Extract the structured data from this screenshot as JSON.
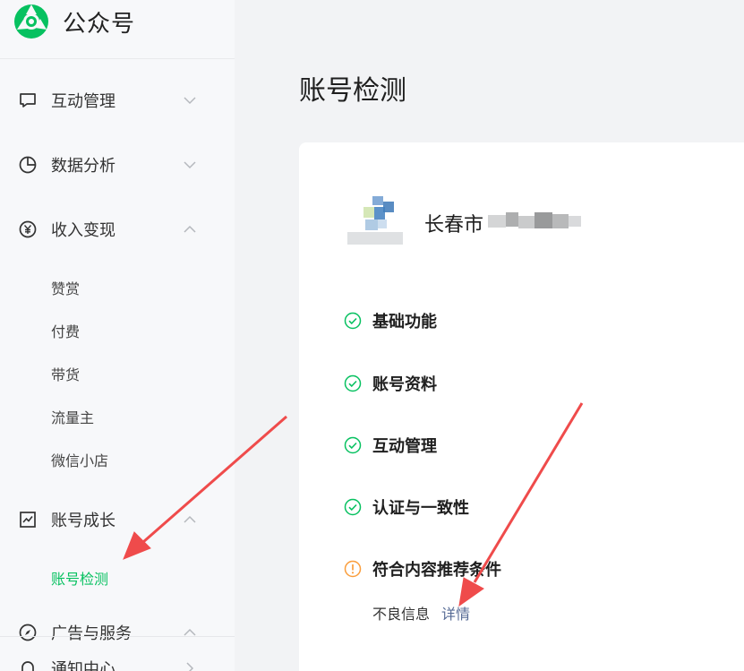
{
  "brand": {
    "name": "公众号"
  },
  "sidebar": {
    "items": [
      {
        "label": "互动管理",
        "icon": "chat-bubble-icon",
        "expanded": false
      },
      {
        "label": "数据分析",
        "icon": "pie-chart-icon",
        "expanded": false
      },
      {
        "label": "收入变现",
        "icon": "yen-circle-icon",
        "expanded": true,
        "sub": [
          "赞赏",
          "付费",
          "带货",
          "流量主",
          "微信小店"
        ]
      },
      {
        "label": "账号成长",
        "icon": "trend-chart-icon",
        "expanded": true,
        "sub": [
          "账号检测"
        ]
      },
      {
        "label": "广告与服务",
        "icon": "compass-icon",
        "expanded": true
      },
      {
        "label": "通知中心",
        "icon": "bell-icon",
        "expanded": false
      }
    ],
    "active_sub": "账号检测"
  },
  "main": {
    "title": "账号检测",
    "account_name": "长春市",
    "checks": [
      {
        "label": "基础功能",
        "status": "ok"
      },
      {
        "label": "账号资料",
        "status": "ok"
      },
      {
        "label": "互动管理",
        "status": "ok"
      },
      {
        "label": "认证与一致性",
        "status": "ok"
      },
      {
        "label": "符合内容推荐条件",
        "status": "warning"
      }
    ],
    "warning_detail": {
      "text": "不良信息",
      "link": "详情"
    }
  },
  "colors": {
    "accent": "#07c160",
    "warning": "#fa9d3b",
    "link": "#576b95",
    "annotation": "#ef4b4b"
  }
}
